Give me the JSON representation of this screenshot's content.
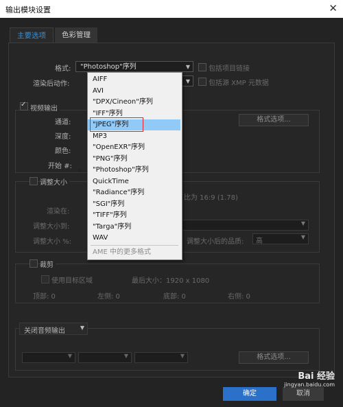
{
  "window": {
    "title": "输出模块设置",
    "close_glyph": "✕"
  },
  "tabs": [
    {
      "label": "主要选项"
    },
    {
      "label": "色彩管理"
    }
  ],
  "format_row": {
    "label": "格式:",
    "selected": "\"Photoshop\"序列",
    "include_link": "包括项目链接"
  },
  "post_render": {
    "label": "渲染后动作:",
    "include_xmp": "包括源 XMP 元数据"
  },
  "video_output": {
    "label": "视频输出",
    "channels_label": "通道:",
    "depth_label": "深度:",
    "color_label": "颜色:",
    "start_label": "开始 #:",
    "format_options_btn": "格式选项..."
  },
  "resize": {
    "label": "调整大小",
    "ratio_text": "比为 16:9 (1.78)",
    "render_at": "渲染在:",
    "resize_to": "调整大小到:",
    "resize_pct": "调整大小 %:",
    "quality_label": "调整大小后的品质:",
    "quality_value": "高"
  },
  "crop": {
    "label": "裁剪",
    "use_roi": "使用目标区域",
    "final_size": "最后大小：1920 x 1080",
    "top": "顶部:  0",
    "left": "左侧:  0",
    "bottom": "底部:  0",
    "right": "右侧:  0"
  },
  "audio": {
    "dropdown": "关闭音频输出",
    "format_options_btn": "格式选项..."
  },
  "footer": {
    "ok": "确定",
    "cancel": "取消"
  },
  "menu": {
    "items": [
      "AIFF",
      "AVI",
      "\"DPX/Cineon\"序列",
      "\"IFF\"序列",
      "\"JPEG\"序列",
      "MP3",
      "\"OpenEXR\"序列",
      "\"PNG\"序列",
      "\"Photoshop\"序列",
      "QuickTime",
      "\"Radiance\"序列",
      "\"SGI\"序列",
      "\"TIFF\"序列",
      "\"Targa\"序列",
      "WAV"
    ],
    "more": "AME 中的更多格式",
    "highlighted_index": 4,
    "checked_index": 8
  },
  "watermark": {
    "brand": "Bai 经验",
    "url": "jingyan.baidu.com"
  },
  "colors": {
    "accent": "#3e8fd0",
    "highlight": "#91c9f7",
    "annotation": "#e0262b",
    "ok_button": "#2b71c9"
  }
}
